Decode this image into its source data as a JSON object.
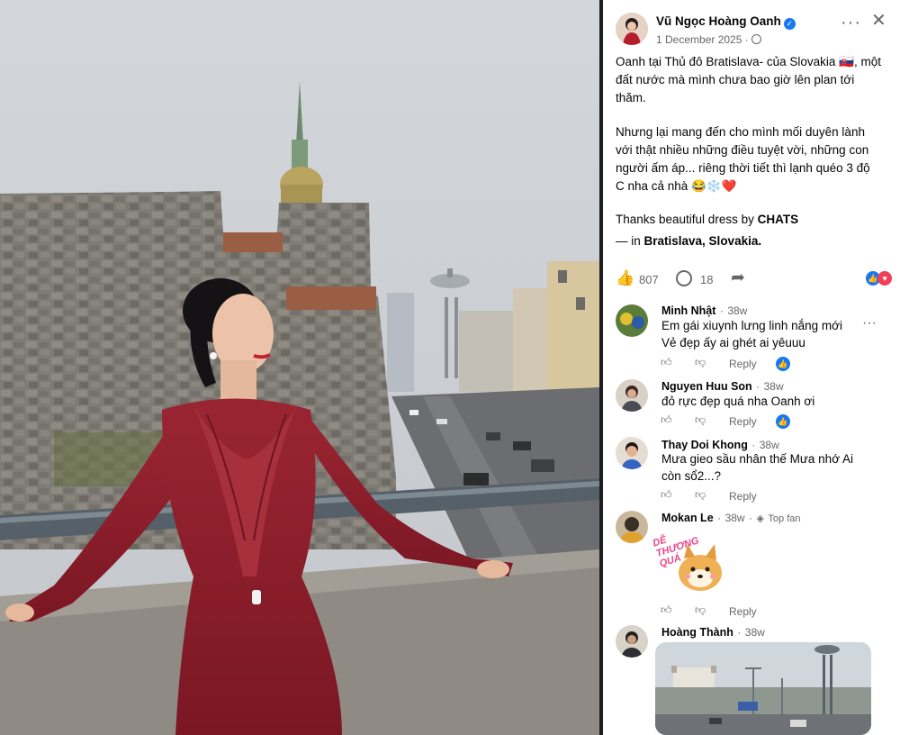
{
  "post": {
    "author": "Vũ Ngọc Hoàng Oanh",
    "date": "1 December 2025",
    "audience_icon": "globe-icon",
    "lines": [
      "Oanh tại Thủ đô Bratislava- của Slovakia 🇸🇰, một",
      "đất nước mà mình chưa bao giờ lên plan tới",
      "thăm.",
      "Nhưng lại mang đến cho mình mối duyên lành",
      "với thật nhiều những điều tuyệt vời, những con",
      "người ấm áp... riêng thời tiết thì lạnh quéo 3 độ",
      "C nha cả nhà 😂❄️❤️"
    ],
    "thanks_prefix": "Thanks beautiful dress by ",
    "thanks_brand": "CHATS",
    "location_prefix": "— in ",
    "location": "Bratislava, Slovakia."
  },
  "stats": {
    "reactions": "807",
    "comments": "18"
  },
  "comments": [
    {
      "name": "Minh Nhật",
      "time": "38w",
      "lines": [
        "Em gái xiuynh lưng linh nắng mới",
        "Vẻ đẹp ấy ai ghét ai yêuuu"
      ],
      "reply": "Reply",
      "has_like": true
    },
    {
      "name": "Nguyen Huu Son",
      "time": "38w",
      "lines": [
        "đỏ rực đẹp quá nha Oanh ơi"
      ],
      "reply": "Reply",
      "has_like": true
    },
    {
      "name": "Thay Doi Khong",
      "time": "38w",
      "lines": [
        "Mưa gieo sầu nhân thế Mưa nhớ Ai",
        "còn sổ2...?"
      ],
      "reply": "Reply",
      "has_like": false
    },
    {
      "name": "Mokan Le",
      "time": "38w",
      "badge": "Top fan",
      "sticker_text": "DỄ THƯƠNG QUÁ",
      "reply": "Reply",
      "has_like": false
    },
    {
      "name": "Hoàng Thành",
      "time": "38w"
    }
  ],
  "colors": {
    "accent": "#1877f2",
    "dress": "#8e1f2a",
    "secondary_text": "#65676b"
  }
}
